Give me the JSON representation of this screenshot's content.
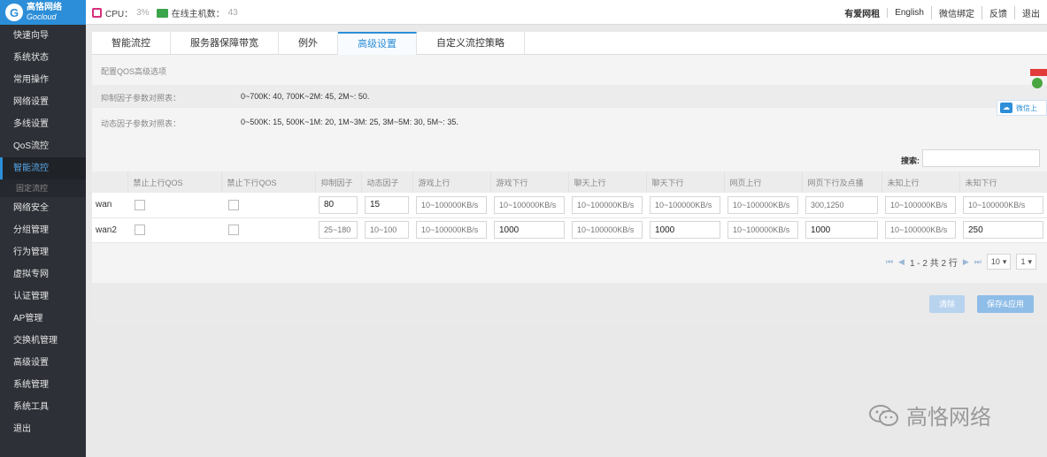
{
  "brand": {
    "cn": "高恪网络",
    "en": "Gocloud",
    "mark": "G"
  },
  "status": {
    "cpu_label": "CPU：",
    "cpu_value": "3%",
    "hosts_label": "在线主机数：",
    "hosts_value": "43"
  },
  "topnav": [
    "有爱网租",
    "English",
    "微信绑定",
    "反馈",
    "退出"
  ],
  "sidebar": {
    "items": [
      "快速向导",
      "系统状态",
      "常用操作",
      "网络设置",
      "多线设置",
      "QoS流控"
    ],
    "active": "智能流控",
    "active_sub": "固定流控",
    "items_after": [
      "网络安全",
      "分组管理",
      "行为管理",
      "虚拟专网",
      "认证管理",
      "AP管理",
      "交换机管理",
      "高级设置",
      "系统管理",
      "系统工具",
      "退出"
    ]
  },
  "tabs": [
    "智能流控",
    "服务器保障带宽",
    "例外",
    "高级设置",
    "自定义流控策略"
  ],
  "active_tab": "高级设置",
  "section_title": "配置QOS高级选项",
  "rows": [
    {
      "label": "抑制因子参数对照表：",
      "value": "0~700K: 40, 700K~2M: 45, 2M~: 50."
    },
    {
      "label": "动态因子参数对照表：",
      "value": "0~500K: 15, 500K~1M: 20, 1M~3M: 25, 3M~5M: 30, 5M~: 35."
    }
  ],
  "search_label": "搜索:",
  "table": {
    "headers": [
      "",
      "禁止上行QOS",
      "禁止下行QOS",
      "抑制因子",
      "动态因子",
      "游戏上行",
      "游戏下行",
      "聊天上行",
      "聊天下行",
      "网页上行",
      "网页下行及点播",
      "未知上行",
      "未知下行"
    ],
    "rows": [
      {
        "name": "wan",
        "suppress": "80",
        "dynamic": "15",
        "game_up": "10~100000KB/s",
        "game_down": "10~100000KB/s",
        "chat_up": "10~100000KB/s",
        "chat_down": "10~100000KB/s",
        "web_up": "10~100000KB/s",
        "web_down": "300,1250",
        "unk_up": "10~100000KB/s",
        "unk_down": "10~100000KB/s"
      },
      {
        "name": "wan2",
        "suppress": "25~180",
        "dynamic": "10~100",
        "game_up": "10~100000KB/s",
        "game_down": "1000",
        "chat_up": "10~100000KB/s",
        "chat_down": "1000",
        "web_up": "10~100000KB/s",
        "web_down": "1000",
        "unk_up": "10~100000KB/s",
        "unk_down": "250"
      }
    ]
  },
  "pager": {
    "info": "1 - 2 共 2 行",
    "page_size": "10",
    "page": "1"
  },
  "buttons": {
    "reset": "清除",
    "save": "保存&应用"
  },
  "float_label": "微信上",
  "watermark": "高恪网络",
  "colors": {
    "accent": "#2c8ed8",
    "sidebar": "#2d3037"
  }
}
